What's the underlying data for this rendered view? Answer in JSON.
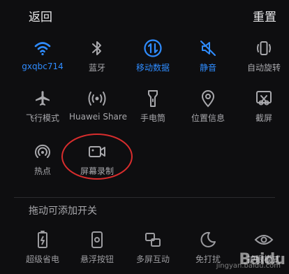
{
  "header": {
    "back": "返回",
    "reset": "重置"
  },
  "active_tiles": [
    {
      "label": "gxqbc714",
      "icon": "wifi-icon",
      "state": "on"
    },
    {
      "label": "蓝牙",
      "icon": "bluetooth-icon",
      "state": "off"
    },
    {
      "label": "移动数据",
      "icon": "mobile-data-icon",
      "state": "on"
    },
    {
      "label": "静音",
      "icon": "mute-icon",
      "state": "on"
    },
    {
      "label": "自动旋转",
      "icon": "auto-rotate-icon",
      "state": "off"
    },
    {
      "label": "飞行模式",
      "icon": "airplane-icon",
      "state": "off"
    },
    {
      "label": "Huawei Share",
      "icon": "huawei-share-icon",
      "state": "off"
    },
    {
      "label": "手电筒",
      "icon": "flashlight-icon",
      "state": "off"
    },
    {
      "label": "位置信息",
      "icon": "location-icon",
      "state": "off"
    },
    {
      "label": "截屏",
      "icon": "screenshot-icon",
      "state": "off"
    },
    {
      "label": "热点",
      "icon": "hotspot-icon",
      "state": "off"
    },
    {
      "label": "屏幕录制",
      "icon": "screen-record-icon",
      "state": "off"
    }
  ],
  "section": {
    "title": "拖动可添加开关"
  },
  "available_tiles": [
    {
      "label": "超级省电",
      "icon": "power-saving-icon"
    },
    {
      "label": "悬浮按钮",
      "icon": "floating-button-icon"
    },
    {
      "label": "多屏互动",
      "icon": "multiscreen-icon"
    },
    {
      "label": "免打扰",
      "icon": "do-not-disturb-icon"
    },
    {
      "label": "护眼模式",
      "icon": "eye-comfort-icon"
    }
  ],
  "watermark": {
    "brand": "Baidu",
    "site": "jingyan.baidu.com"
  },
  "colors": {
    "active": "#2f8cff",
    "inactive": "#a8a8ac",
    "annotation": "#d82d2d"
  }
}
